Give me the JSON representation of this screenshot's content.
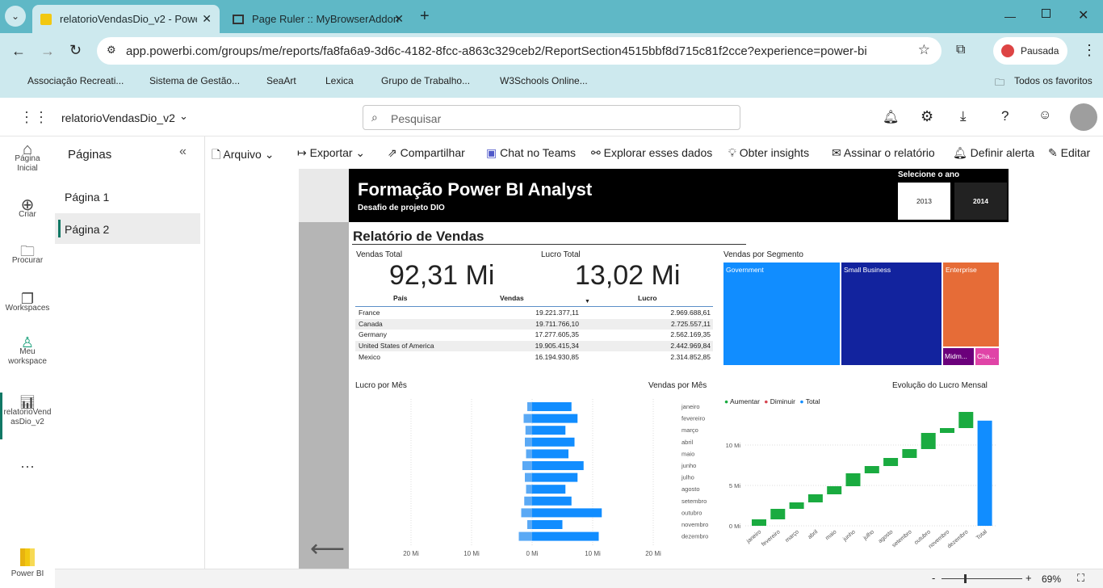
{
  "browser": {
    "tabs": [
      {
        "title": "relatorioVendasDio_v2 - Power"
      },
      {
        "title": "Page Ruler :: MyBrowserAddon"
      }
    ],
    "url": "app.powerbi.com/groups/me/reports/fa8fa6a9-3d6c-4182-8fcc-a863c329ceb2/ReportSection4515bbf8d715c81f2cce?experience=power-bi",
    "profile_label": "Pausada",
    "bookmarks": [
      "Associação Recreati...",
      "Sistema de Gestão...",
      "SeaArt",
      "Lexica",
      "Grupo de Trabalho...",
      "W3Schools Online...",
      "Todos os favoritos"
    ]
  },
  "pbi": {
    "report_name": "relatorioVendasDio_v2",
    "search_placeholder": "Pesquisar",
    "rail": [
      {
        "label": "Página Inicial"
      },
      {
        "label": "Criar"
      },
      {
        "label": "Procurar"
      },
      {
        "label": "Workspaces"
      },
      {
        "label": "Meu workspace"
      },
      {
        "label": "relatorioVendasDio_v2"
      },
      {
        "label": "Power BI"
      }
    ],
    "pages_title": "Páginas",
    "pages": [
      "Página 1",
      "Página 2"
    ],
    "toolbar": [
      "Arquivo",
      "Exportar",
      "Compartilhar",
      "Chat no Teams",
      "Explorar esses dados",
      "Obter insights",
      "Assinar o relatório",
      "Definir alerta",
      "Editar"
    ],
    "zoom": "69%"
  },
  "report": {
    "title": "Formação Power BI Analyst",
    "subtitle": "Desafio de projeto DIO",
    "year_label": "Selecione o ano",
    "years": [
      "2013",
      "2014"
    ],
    "section_title": "Relatório de Vendas",
    "kpi_sales_label": "Vendas Total",
    "kpi_sales_value": "92,31 Mi",
    "kpi_profit_label": "Lucro Total",
    "kpi_profit_value": "13,02 Mi",
    "table_headers": [
      "País",
      "Vendas",
      "Lucro"
    ],
    "table_rows": [
      [
        "France",
        "19.221.377,11",
        "2.969.688,61"
      ],
      [
        "Canada",
        "19.711.766,10",
        "2.725.557,11"
      ],
      [
        "Germany",
        "17.277.605,35",
        "2.562.169,35"
      ],
      [
        "United States of America",
        "19.905.415,34",
        "2.442.969,84"
      ],
      [
        "Mexico",
        "16.194.930,85",
        "2.314.852,85"
      ]
    ],
    "segment_title": "Vendas por Segmento",
    "segments": [
      "Government",
      "Small Business",
      "Enterprise",
      "Midm...",
      "Cha..."
    ],
    "bar_title_left": "Lucro por Mês",
    "bar_title_right": "Vendas por Mês",
    "waterfall_title": "Evolução do Lucro Mensal",
    "waterfall_legend": [
      "Aumentar",
      "Diminuir",
      "Total"
    ]
  },
  "chart_data": [
    {
      "type": "bar",
      "categories": [
        "janeiro",
        "fevereiro",
        "março",
        "abril",
        "maio",
        "junho",
        "julho",
        "agosto",
        "setembro",
        "outubro",
        "novembro",
        "dezembro"
      ],
      "series": [
        {
          "name": "Lucro por Mês",
          "values": [
            -0.8,
            -1.4,
            -1.1,
            -1.2,
            -1.0,
            -1.6,
            -1.2,
            -1.0,
            -1.3,
            -1.8,
            -0.8,
            -2.2
          ]
        },
        {
          "name": "Vendas por Mês",
          "values": [
            6.5,
            7.5,
            5.5,
            7.0,
            6.0,
            8.5,
            7.5,
            5.5,
            6.5,
            11.5,
            5.0,
            11.0
          ]
        }
      ],
      "xticks": [
        "20 Mi",
        "10 Mi",
        "0 Mi",
        "10 Mi",
        "20 Mi"
      ]
    },
    {
      "type": "bar",
      "title": "Evolução do Lucro Mensal",
      "categories": [
        "janeiro",
        "fevereiro",
        "março",
        "abril",
        "maio",
        "junho",
        "julho",
        "agosto",
        "setembro",
        "outubro",
        "novembro",
        "dezembro",
        "Total"
      ],
      "values": [
        0.8,
        1.3,
        0.8,
        1.0,
        1.0,
        1.6,
        0.9,
        1.0,
        1.1,
        2.0,
        0.6,
        2.0,
        13.02
      ],
      "yticks": [
        "0 Mi",
        "5 Mi",
        "10 Mi"
      ],
      "ylim": [
        0,
        13.02
      ],
      "legend": [
        "Aumentar",
        "Diminuir",
        "Total"
      ]
    }
  ]
}
